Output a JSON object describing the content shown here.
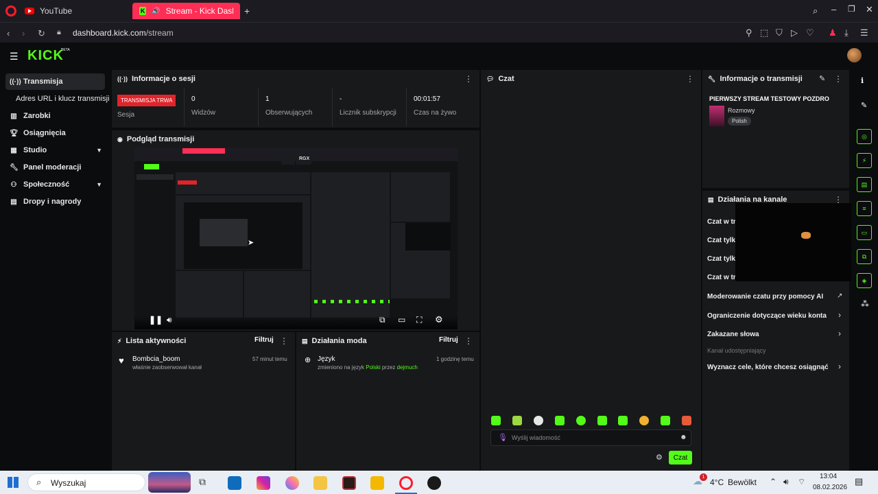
{
  "browser": {
    "tab1_title": "YouTube",
    "tab2_title": "Stream - Kick Dashbo",
    "new_tab": "+",
    "url_host": "dashboard.kick.com",
    "url_path": "/stream"
  },
  "kick": {
    "logo": "KICK",
    "beta": "BETA"
  },
  "sidebar": {
    "items": [
      {
        "label": "Transmisja",
        "icon": "broadcast-icon"
      },
      {
        "label": "Adres URL i klucz transmisji",
        "icon": ""
      },
      {
        "label": "Zarobki",
        "icon": "chart-icon"
      },
      {
        "label": "Osiągnięcia",
        "icon": "trophy-icon"
      },
      {
        "label": "Studio",
        "icon": "studio-icon"
      },
      {
        "label": "Panel moderacji",
        "icon": "wrench-icon"
      },
      {
        "label": "Społeczność",
        "icon": "community-icon"
      },
      {
        "label": "Dropy i nagrody",
        "icon": "gift-icon"
      }
    ]
  },
  "session": {
    "title": "Informacje o sesji",
    "live_badge": "TRANSMISJA TRWA",
    "session_label": "Sesja",
    "stats": [
      {
        "value": "0",
        "label": "Widzów"
      },
      {
        "value": "1",
        "label": "Obserwujących"
      },
      {
        "value": "-",
        "label": "Licznik subskrypcji"
      },
      {
        "value": "00:01:57",
        "label": "Czas na żywo"
      }
    ]
  },
  "preview": {
    "title": "Podgląd transmisji",
    "overlay_label": "RGX"
  },
  "activity": {
    "title": "Lista aktywności",
    "filter": "Filtruj",
    "entries": [
      {
        "user": "Bombcia_boom",
        "desc": "właśnie zaobserwował kanał",
        "time": "57 minut temu"
      }
    ]
  },
  "modactions": {
    "title": "Działania moda",
    "filter": "Filtruj",
    "entries": [
      {
        "title": "Język",
        "desc_pre": "zmieniono na język ",
        "lang": "Polski",
        "desc_mid": " przez ",
        "user": "dejmuch",
        "time": "1 godzinę temu"
      }
    ]
  },
  "chat": {
    "title": "Czat",
    "placeholder": "Wyślij wiadomość",
    "send_label": "Czat"
  },
  "stream_info": {
    "title": "Informacje o transmisji",
    "stream_title": "PIERWSZY STREAM TESTOWY POZDRO",
    "category": "Rozmowy",
    "language_tag": "Polish"
  },
  "channel_actions": {
    "title": "Działania na kanale",
    "rows": [
      {
        "label": "Czat w try"
      },
      {
        "label": "Czat tylko"
      },
      {
        "label": "Czat tylko"
      },
      {
        "label": "Czat w try"
      },
      {
        "label": "Moderowanie czatu przy pomocy AI"
      },
      {
        "label": "Ograniczenie dotyczące wieku konta"
      },
      {
        "label": "Zakazane słowa"
      },
      {
        "label": "Kanał udostępniający"
      },
      {
        "label": "Wyznacz cele, które chcesz osiągnąć"
      }
    ]
  },
  "taskbar": {
    "search": "Wyszukaj",
    "weather_temp": "4°C",
    "weather_desc": "Bewölkt",
    "time": "13:04",
    "date": "08.02.2026",
    "weather_badge": "1"
  },
  "colors": {
    "kick_green": "#53fc18",
    "opera_red": "#ff2e55",
    "live_red": "#e1242a"
  }
}
